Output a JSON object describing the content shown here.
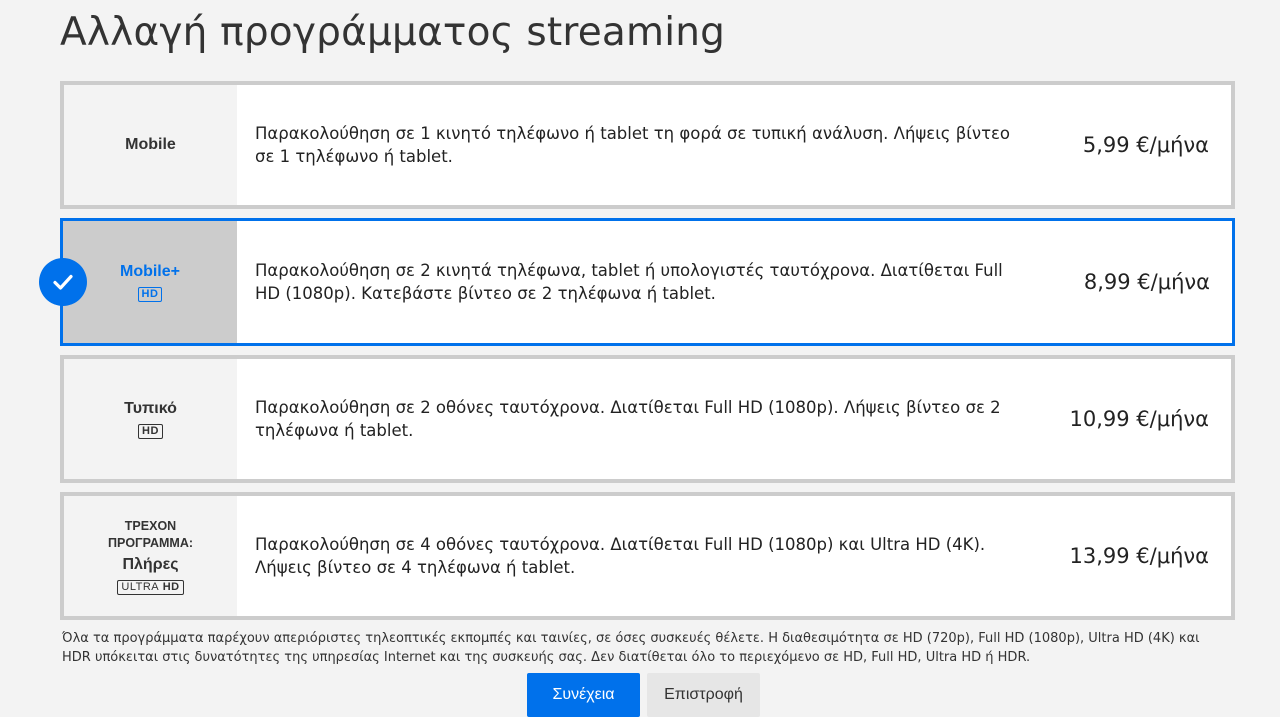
{
  "page": {
    "title": "Αλλαγή προγράμματος streaming"
  },
  "plans": [
    {
      "name": "Mobile",
      "quality": "",
      "current_label": "",
      "description": "Παρακολούθηση σε 1 κινητό τηλέφωνο ή tablet τη φορά σε τυπική ανάλυση. Λήψεις βίντεο σε 1 τηλέφωνο ή tablet.",
      "price": "5,99 €/μήνα",
      "selected": false
    },
    {
      "name": "Mobile+",
      "quality": "HD",
      "current_label": "",
      "description": "Παρακολούθηση σε 2 κινητά τηλέφωνα, tablet ή υπολογιστές ταυτόχρονα. Διατίθεται Full HD (1080p). Κατεβάστε βίντεο σε 2 τηλέφωνα ή tablet.",
      "price": "8,99 €/μήνα",
      "selected": true
    },
    {
      "name": "Τυπικό",
      "quality": "HD",
      "current_label": "",
      "description": "Παρακολούθηση σε 2 οθόνες ταυτόχρονα. Διατίθεται Full HD (1080p). Λήψεις βίντεο σε 2 τηλέφωνα ή tablet.",
      "price": "10,99 €/μήνα",
      "selected": false
    },
    {
      "name": "Πλήρες",
      "quality_prefix": "ULTRA",
      "quality": "HD",
      "current_label": "ΤΡΕΧΟΝ ΠΡΟΓΡΑΜΜΑ:",
      "description": "Παρακολούθηση σε 4 οθόνες ταυτόχρονα. Διατίθεται Full HD (1080p) και Ultra HD (4K). Λήψεις βίντεο σε 4 τηλέφωνα ή tablet.",
      "price": "13,99 €/μήνα",
      "selected": false
    }
  ],
  "footnote": "Όλα τα προγράμματα παρέχουν απεριόριστες τηλεοπτικές εκπομπές και ταινίες, σε όσες συσκευές θέλετε. Η διαθεσιμότητα σε HD (720p), Full HD (1080p), Ultra HD (4K) και HDR υπόκειται στις δυνατότητες της υπηρεσίας Internet και της συσκευής σας. Δεν διατίθεται όλο το περιεχόμενο σε HD, Full HD, Ultra HD ή HDR.",
  "actions": {
    "continue_label": "Συνέχεια",
    "back_label": "Επιστροφή"
  },
  "colors": {
    "accent": "#0071eb",
    "card_border": "#cccccc",
    "background": "#f3f3f3"
  },
  "icons": {
    "selected_marker": "checkmark-icon"
  }
}
